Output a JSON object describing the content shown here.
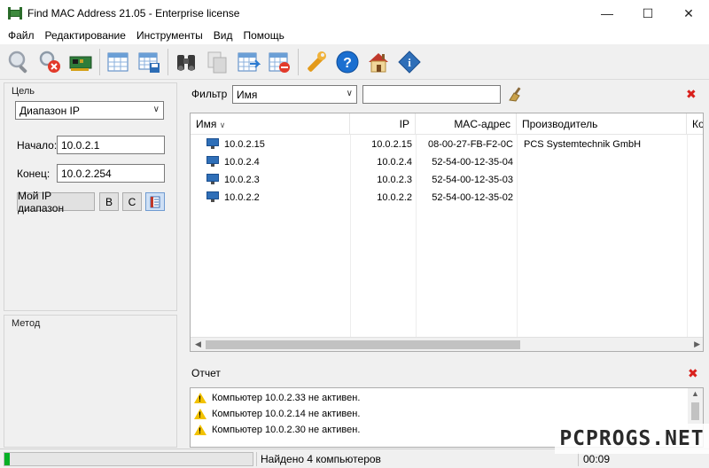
{
  "window": {
    "title": "Find MAC Address 21.05 - Enterprise license",
    "controls": [
      "—",
      "☐",
      "✕"
    ]
  },
  "menu": [
    "Файл",
    "Редактирование",
    "Инструменты",
    "Вид",
    "Помощь"
  ],
  "toolbar": {
    "buttons": [
      "search",
      "stop-search",
      "network-card",
      "export-table",
      "save-table",
      "binoculars",
      "copy",
      "export",
      "delete-table",
      "wrench",
      "help",
      "home",
      "info"
    ]
  },
  "target": {
    "title": "Цель",
    "range_type": "Диапазон IP",
    "start_label": "Начало:",
    "start_value": "10.0.2.1",
    "end_label": "Конец:",
    "end_value": "10.0.2.254",
    "my_range_button": "Мой IP диапазон",
    "b_button": "B",
    "c_button": "C"
  },
  "method": {
    "title": "Метод"
  },
  "filter": {
    "label": "Фильтр",
    "field": "Имя",
    "value": ""
  },
  "table": {
    "columns": [
      "Имя",
      "IP",
      "MAC-адрес",
      "Производитель",
      "Ко"
    ],
    "rows": [
      {
        "name": "10.0.2.15",
        "ip": "10.0.2.15",
        "mac": "08-00-27-FB-F2-0C",
        "vendor": "PCS Systemtechnik GmbH"
      },
      {
        "name": "10.0.2.4",
        "ip": "10.0.2.4",
        "mac": "52-54-00-12-35-04",
        "vendor": ""
      },
      {
        "name": "10.0.2.3",
        "ip": "10.0.2.3",
        "mac": "52-54-00-12-35-03",
        "vendor": ""
      },
      {
        "name": "10.0.2.2",
        "ip": "10.0.2.2",
        "mac": "52-54-00-12-35-02",
        "vendor": ""
      }
    ]
  },
  "report": {
    "title": "Отчет",
    "lines": [
      "Компьютер 10.0.2.33 не активен.",
      "Компьютер 10.0.2.14 не активен.",
      "Компьютер 10.0.2.30 не активен."
    ]
  },
  "status": {
    "progress": 0.01,
    "text": "Найдено 4 компьютеров",
    "time": "00:09"
  },
  "watermark": "PCPROGS.NET"
}
